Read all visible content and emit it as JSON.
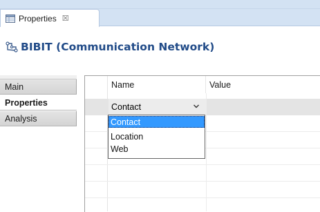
{
  "view_tab": {
    "label": "Properties",
    "close_glyph": "☒",
    "icon": "properties-table-icon"
  },
  "title": {
    "text": "BIBIT (Communication Network)",
    "icon": "network-link-icon",
    "color": "#214b88"
  },
  "side_tabs": [
    {
      "label": "Main",
      "active": false
    },
    {
      "label": "Properties",
      "active": true
    },
    {
      "label": "Analysis",
      "active": false
    }
  ],
  "table": {
    "columns": [
      "Name",
      "Value"
    ],
    "combo": {
      "value": "Contact",
      "arrow_icon": "chevron-down-icon"
    }
  },
  "dropdown": {
    "options": [
      "Contact",
      "Location",
      "Web"
    ],
    "selected_index": 0,
    "selection_color": "#3399ff"
  }
}
